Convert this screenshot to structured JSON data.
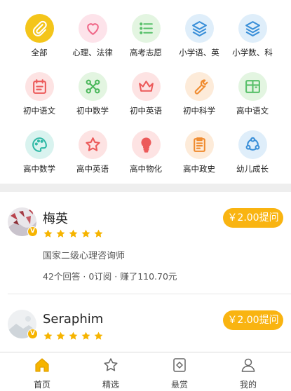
{
  "categories": [
    {
      "label": "全部",
      "icon": "paperclip-icon",
      "bg": "#f4c51a",
      "fg": "#ffffff"
    },
    {
      "label": "心理、法律",
      "icon": "heart-icon",
      "bg": "#fde3ea",
      "fg": "#f06a8a"
    },
    {
      "label": "高考志愿",
      "icon": "list-icon",
      "bg": "#e3f5e1",
      "fg": "#58c06a"
    },
    {
      "label": "小学语、英",
      "icon": "layers-icon",
      "bg": "#dfeefa",
      "fg": "#3a8fd8"
    },
    {
      "label": "小学数、科",
      "icon": "layers-icon",
      "bg": "#dfeefa",
      "fg": "#3a8fd8"
    },
    {
      "label": "初中语文",
      "icon": "calendar-icon",
      "bg": "#fde3e3",
      "fg": "#ec5a5a"
    },
    {
      "label": "初中数学",
      "icon": "network-icon",
      "bg": "#e3f5e1",
      "fg": "#4cb85c"
    },
    {
      "label": "初中英语",
      "icon": "crown-icon",
      "bg": "#fde3e3",
      "fg": "#ec5a5a"
    },
    {
      "label": "初中科学",
      "icon": "wrench-icon",
      "bg": "#fdebd9",
      "fg": "#f08b2e"
    },
    {
      "label": "高中语文",
      "icon": "book-icon",
      "bg": "#e3f5e1",
      "fg": "#58c06a"
    },
    {
      "label": "高中数学",
      "icon": "palette-icon",
      "bg": "#d9f3ef",
      "fg": "#30b9a6"
    },
    {
      "label": "高中英语",
      "icon": "star-icon",
      "bg": "#fde3e3",
      "fg": "#ec5a5a"
    },
    {
      "label": "高中物化",
      "icon": "bulb-icon",
      "bg": "#fde3e3",
      "fg": "#ec5a5a"
    },
    {
      "label": "高中政史",
      "icon": "clipboard-icon",
      "bg": "#fdebd9",
      "fg": "#f08b2e"
    },
    {
      "label": "幼儿成长",
      "icon": "share-icon",
      "bg": "#dfeefa",
      "fg": "#3a8fd8"
    }
  ],
  "experts": [
    {
      "name": "梅英",
      "price_label": "￥2.00提问",
      "title": "国家二级心理咨询师",
      "stats": "42个回答 · 0订阅 · 赚了110.70元",
      "rating": 5
    },
    {
      "name": "Seraphim",
      "price_label": "￥2.00提问",
      "rating": 5
    }
  ],
  "badge_glyph": "V",
  "tabs": [
    {
      "label": "首页",
      "icon": "home-icon",
      "active": true
    },
    {
      "label": "精选",
      "icon": "star-outline-icon",
      "active": false
    },
    {
      "label": "悬赏",
      "icon": "bounty-icon",
      "active": false
    },
    {
      "label": "我的",
      "icon": "person-icon",
      "active": false
    }
  ],
  "colors": {
    "accent": "#f9b411",
    "star": "#f6b400",
    "tab_active": "#f6b400"
  }
}
